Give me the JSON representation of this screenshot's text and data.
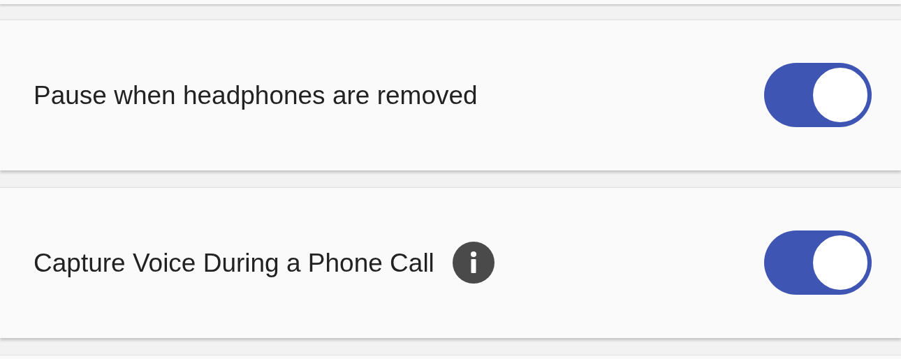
{
  "settings": [
    {
      "label": "Pause when headphones are removed",
      "on": true,
      "info": false
    },
    {
      "label": "Capture Voice During a Phone Call",
      "on": true,
      "info": true
    }
  ]
}
